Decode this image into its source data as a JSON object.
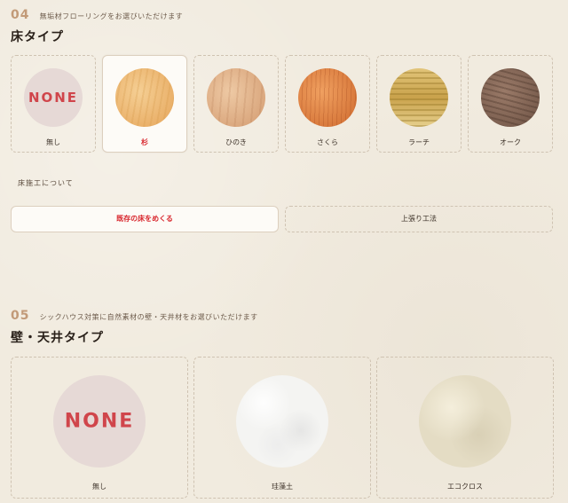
{
  "section04": {
    "number": "04",
    "subtitle": "無垢材フローリングをお選びいただけます",
    "title": "床タイプ",
    "options": [
      {
        "label": "無し",
        "badge": "NONE",
        "selected": false
      },
      {
        "label": "杉",
        "selected": true,
        "icon": "sugi-wood-icon"
      },
      {
        "label": "ひのき",
        "selected": false,
        "icon": "hinoki-wood-icon"
      },
      {
        "label": "さくら",
        "selected": false,
        "icon": "sakura-wood-icon"
      },
      {
        "label": "ラーチ",
        "selected": false,
        "icon": "larch-wood-icon"
      },
      {
        "label": "オーク",
        "selected": false,
        "icon": "oak-wood-icon"
      }
    ],
    "construction_heading": "床施工について",
    "methods": [
      {
        "label": "既存の床をめくる",
        "selected": true
      },
      {
        "label": "上張り工法",
        "selected": false
      }
    ]
  },
  "section05": {
    "number": "05",
    "subtitle": "シックハウス対策に自然素材の壁・天井材をお選びいただけます",
    "title": "壁・天井タイプ",
    "options": [
      {
        "label": "無し",
        "badge": "NONE"
      },
      {
        "label": "珪藻土",
        "icon": "diatomite-texture-icon"
      },
      {
        "label": "エコクロス",
        "icon": "eco-cloth-texture-icon"
      }
    ]
  },
  "colors": {
    "background": "#f1ebdf",
    "accent_red": "#d8262d",
    "number_color": "#c29a78",
    "none_circle": "#e6d9d6"
  }
}
